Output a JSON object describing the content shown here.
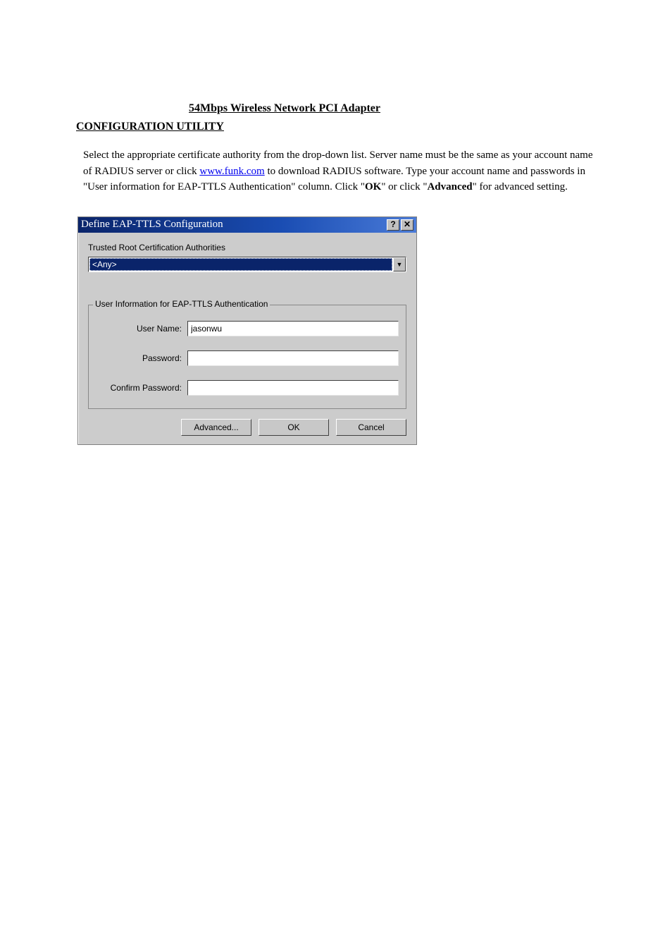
{
  "doc": {
    "header_line": "54Mbps Wireless Network PCI Adapter",
    "subheader_line": "CONFIGURATION UTILITY",
    "intro1": "Select the appropriate certificate authority from the drop-down list. Server name must be the same as your account name of RADIUS server or click ",
    "funk_link": "www.funk.com",
    "intro2": " to download RADIUS software. Type your account name and passwords in \"User information for EAP-TTLS Authentication\" column. Click \"",
    "ok_inline": "OK",
    "intro3": "\" or click \"",
    "advanced_inline": "Advanced",
    "intro4": "\" for advanced setting."
  },
  "dialog": {
    "title": "Define EAP-TTLS Configuration",
    "authorities_label": "Trusted Root Certification Authorities",
    "dropdown_value": "<Any>",
    "fieldset_legend": "User Information for EAP-TTLS Authentication",
    "username_label": "User Name:",
    "username_value": "jasonwu",
    "password_label": "Password:",
    "password_value": "",
    "confirm_label": "Confirm Password:",
    "confirm_value": "",
    "btn_advanced": "Advanced...",
    "btn_ok": "OK",
    "btn_cancel": "Cancel"
  }
}
